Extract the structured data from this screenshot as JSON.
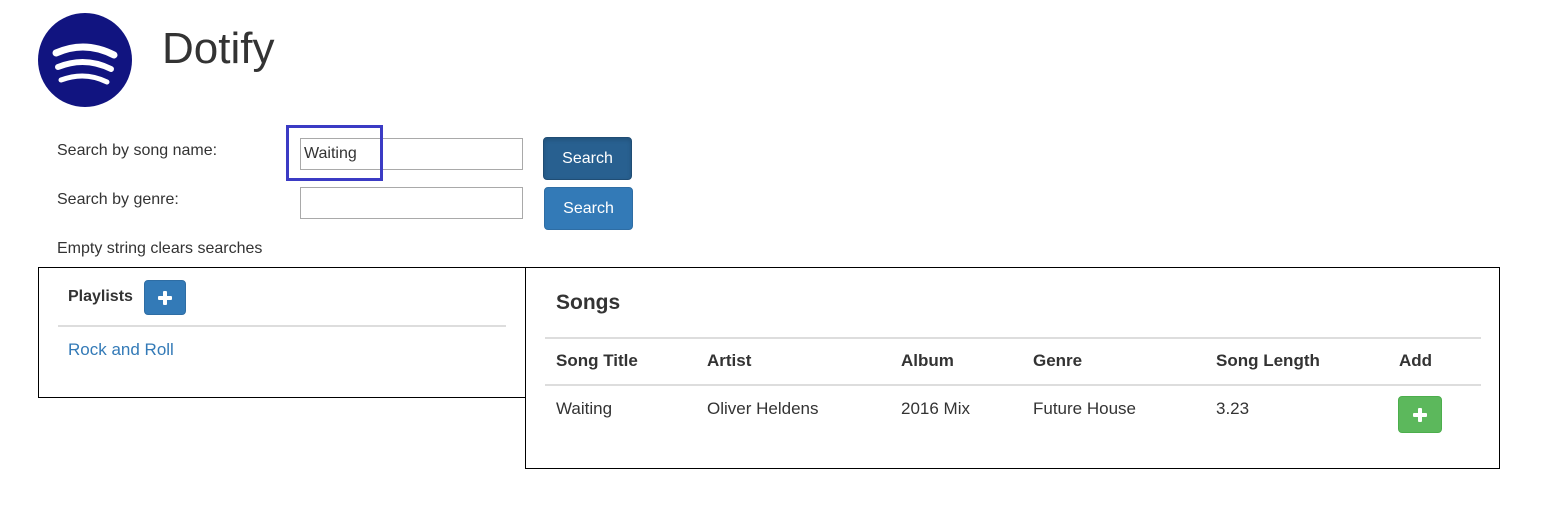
{
  "app": {
    "title": "Dotify",
    "brand_color": "#111480"
  },
  "search": {
    "song_label": "Search by song name:",
    "song_value": "Waiting",
    "song_button": "Search",
    "genre_label": "Search by genre:",
    "genre_value": "",
    "genre_button": "Search",
    "hint": "Empty string clears searches"
  },
  "playlists": {
    "heading": "Playlists",
    "add_icon": "plus-icon",
    "items": [
      {
        "label": "Rock and Roll"
      }
    ]
  },
  "songs": {
    "heading": "Songs",
    "columns": [
      "Song Title",
      "Artist",
      "Album",
      "Genre",
      "Song Length",
      "Add"
    ],
    "rows": [
      {
        "title": "Waiting",
        "artist": "Oliver Heldens",
        "album": "2016 Mix",
        "genre": "Future House",
        "length": "3.23",
        "add_icon": "plus-icon"
      }
    ]
  },
  "colors": {
    "primary": "#337ab7",
    "success": "#5cb85c",
    "link": "#337ab7",
    "highlight": "#3b3bc4"
  }
}
